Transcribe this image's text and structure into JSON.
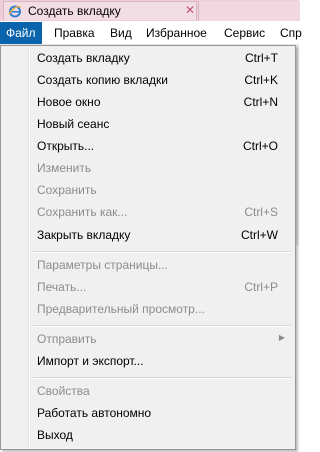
{
  "tab": {
    "title": "Создать вкладку",
    "close": "✕"
  },
  "menubar": {
    "items": [
      "Файл",
      "Правка",
      "Вид",
      "Избранное",
      "Сервис",
      "Спр"
    ]
  },
  "menu": {
    "items": [
      {
        "label": "Создать вкладку",
        "shortcut": "Ctrl+T"
      },
      {
        "label": "Создать копию вкладки",
        "shortcut": "Ctrl+K"
      },
      {
        "label": "Новое окно",
        "shortcut": "Ctrl+N"
      },
      {
        "label": "Новый сеанс",
        "shortcut": ""
      },
      {
        "label": "Открыть...",
        "shortcut": "Ctrl+O"
      },
      {
        "label": "Изменить",
        "shortcut": ""
      },
      {
        "label": "Сохранить",
        "shortcut": ""
      },
      {
        "label": "Сохранить как...",
        "shortcut": "Ctrl+S"
      },
      {
        "label": "Закрыть вкладку",
        "shortcut": "Ctrl+W"
      },
      {
        "label": "Параметры страницы...",
        "shortcut": ""
      },
      {
        "label": "Печать...",
        "shortcut": "Ctrl+P"
      },
      {
        "label": "Предварительный просмотр...",
        "shortcut": ""
      },
      {
        "label": "Отправить",
        "shortcut": ""
      },
      {
        "label": "Импорт и экспорт...",
        "shortcut": ""
      },
      {
        "label": "Свойства",
        "shortcut": ""
      },
      {
        "label": "Работать автономно",
        "shortcut": ""
      },
      {
        "label": "Выход",
        "shortcut": ""
      }
    ]
  },
  "colors": {
    "menu_active": "#0a64ad",
    "disabled_text": "#8c8c8c",
    "tab_bg": "#f3dde5"
  },
  "icons": {
    "tab_icon": "ie-logo-icon",
    "submenu": "chevron-right-icon"
  }
}
